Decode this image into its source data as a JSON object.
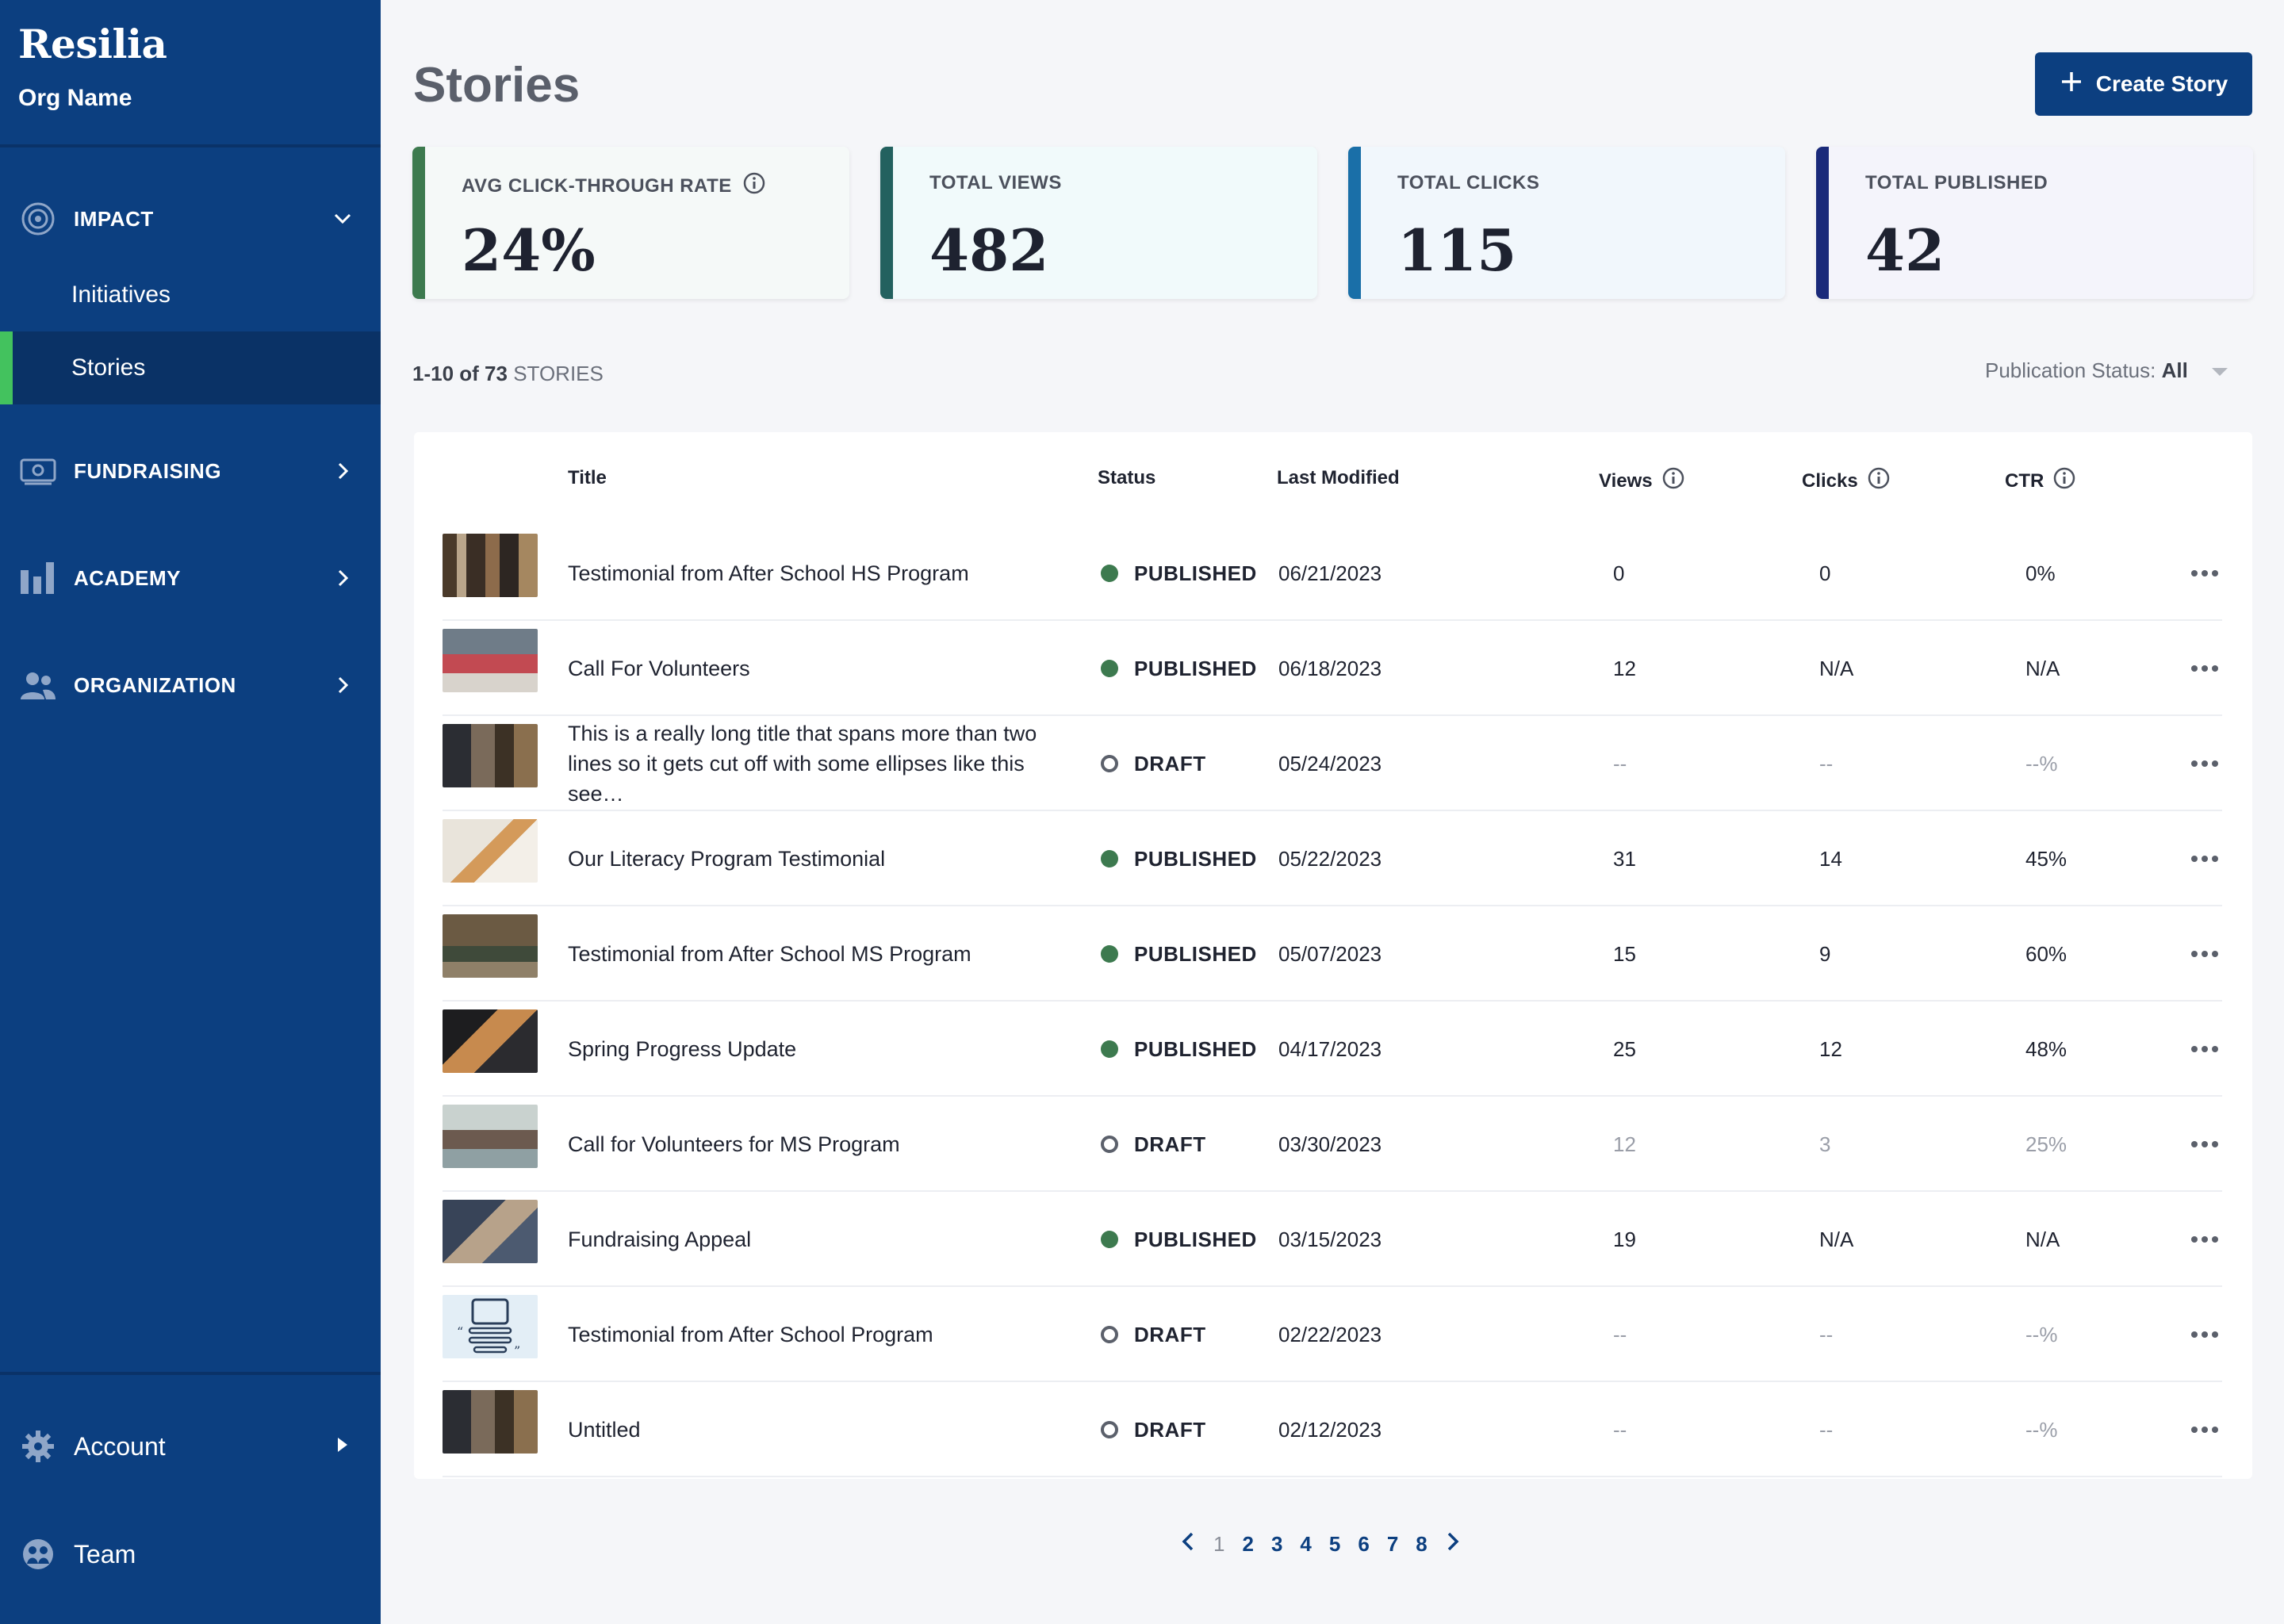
{
  "brand": {
    "name": "Resilia",
    "org": "Org Name"
  },
  "nav": {
    "impact": "IMPACT",
    "initiatives": "Initiatives",
    "stories": "Stories",
    "fundraising": "FUNDRAISING",
    "academy": "ACADEMY",
    "organization": "ORGANIZATION",
    "account": "Account",
    "team": "Team"
  },
  "header": {
    "title": "Stories",
    "create_label": "Create Story"
  },
  "kpis": [
    {
      "label": "AVG CLICK-THROUGH RATE",
      "value": "24%",
      "accent": "#3d7a4f",
      "bg": "#f5f9f8"
    },
    {
      "label": "TOTAL VIEWS",
      "value": "482",
      "accent": "#23615f",
      "bg": "#f1fafb"
    },
    {
      "label": "TOTAL CLICKS",
      "value": "115",
      "accent": "#1a6fa8",
      "bg": "#f1f7fc"
    },
    {
      "label": "TOTAL PUBLISHED",
      "value": "42",
      "accent": "#1a2a7a",
      "bg": "#f4f4fb"
    }
  ],
  "list": {
    "range": "1-10 of 73",
    "unit": "STORIES",
    "filter_label": "Publication Status:",
    "filter_value": "All"
  },
  "table": {
    "headers": {
      "title": "Title",
      "status": "Status",
      "modified": "Last Modified",
      "views": "Views",
      "clicks": "Clicks",
      "ctr": "CTR"
    },
    "rows": [
      {
        "title": "Testimonial from After School HS Program",
        "status": "PUBLISHED",
        "date": "06/21/2023",
        "views": "0",
        "clicks": "0",
        "ctr": "0%"
      },
      {
        "title": "Call For Volunteers",
        "status": "PUBLISHED",
        "date": "06/18/2023",
        "views": "12",
        "clicks": "N/A",
        "ctr": "N/A"
      },
      {
        "title": "This is a really long title that spans more than two lines so it gets cut off with some ellipses like this see…",
        "status": "DRAFT",
        "date": "05/24/2023",
        "views": "--",
        "clicks": "--",
        "ctr": "--%"
      },
      {
        "title": "Our Literacy Program Testimonial",
        "status": "PUBLISHED",
        "date": "05/22/2023",
        "views": "31",
        "clicks": "14",
        "ctr": "45%"
      },
      {
        "title": "Testimonial from After School MS Program",
        "status": "PUBLISHED",
        "date": "05/07/2023",
        "views": "15",
        "clicks": "9",
        "ctr": "60%"
      },
      {
        "title": "Spring Progress Update",
        "status": "PUBLISHED",
        "date": "04/17/2023",
        "views": "25",
        "clicks": "12",
        "ctr": "48%"
      },
      {
        "title": "Call for Volunteers for MS Program",
        "status": "DRAFT",
        "date": "03/30/2023",
        "views": "12",
        "clicks": "3",
        "ctr": "25%"
      },
      {
        "title": "Fundraising Appeal",
        "status": "PUBLISHED",
        "date": "03/15/2023",
        "views": "19",
        "clicks": "N/A",
        "ctr": "N/A"
      },
      {
        "title": "Testimonial from After School Program",
        "status": "DRAFT",
        "date": "02/22/2023",
        "views": "--",
        "clicks": "--",
        "ctr": "--%"
      },
      {
        "title": "Untitled",
        "status": "DRAFT",
        "date": "02/12/2023",
        "views": "--",
        "clicks": "--",
        "ctr": "--%"
      }
    ]
  },
  "pagination": {
    "pages": [
      "1",
      "2",
      "3",
      "4",
      "5",
      "6",
      "7",
      "8"
    ],
    "current": "1"
  },
  "colors": {
    "sidebar": "#0c3f80",
    "active_indicator": "#43c25e",
    "published_dot": "#3d7a4f"
  }
}
